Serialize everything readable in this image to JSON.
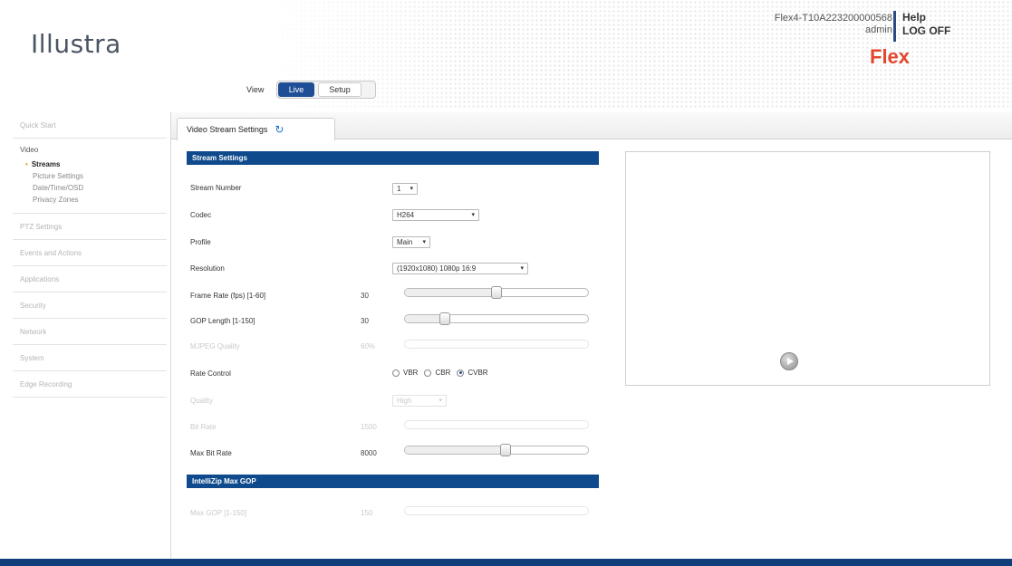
{
  "header": {
    "logo": "Illustra",
    "device_name": "Flex4-T10A2232000005​68",
    "user": "admin",
    "help": "Help",
    "logoff": "LOG OFF",
    "brand": "Flex"
  },
  "view": {
    "label": "View",
    "live": "Live",
    "setup": "Setup"
  },
  "sidebar": {
    "quick_start": "Quick Start",
    "video_section": "Video",
    "video_items": [
      "Streams",
      "Picture Settings",
      "Date/Time/OSD",
      "Privacy Zones"
    ],
    "items": [
      "PTZ Settings",
      "Events and Actions",
      "Applications",
      "Security",
      "Network",
      "System",
      "Edge Recording"
    ]
  },
  "tab": {
    "label": "Video Stream Settings",
    "refresh_icon": "refresh-icon"
  },
  "stream_settings": {
    "header": "Stream Settings",
    "stream_number_label": "Stream Number",
    "stream_number_value": "1",
    "codec_label": "Codec",
    "codec_value": "H264",
    "profile_label": "Profile",
    "profile_value": "Main",
    "resolution_label": "Resolution",
    "resolution_value": "(1920x1080) 1080p 16:9",
    "frame_rate_label": "Frame Rate (fps) [1-60]",
    "frame_rate_value": "30",
    "frame_rate_fraction": 0.5,
    "gop_label": "GOP Length [1-150]",
    "gop_value": "30",
    "gop_fraction": 0.2,
    "mjpeg_label": "MJPEG Quality",
    "mjpeg_value": "60%",
    "rate_control_label": "Rate Control",
    "rate_options": [
      "VBR",
      "CBR",
      "CVBR"
    ],
    "rate_selected": "CVBR",
    "quality_label": "Quality",
    "quality_value": "High",
    "bit_rate_label": "Bit Rate",
    "bit_rate_value": "1500",
    "max_bit_rate_label": "Max Bit Rate",
    "max_bit_rate_value": "8000",
    "max_bit_rate_fraction": 0.55
  },
  "intellizip": {
    "header": "IntelliZip Max GOP",
    "max_gop_label": "Max GOP [1-150]",
    "max_gop_value": "150"
  },
  "colors": {
    "primary": "#0e4a8c",
    "accent": "#e2472e",
    "footer": "#0f3f7a"
  }
}
